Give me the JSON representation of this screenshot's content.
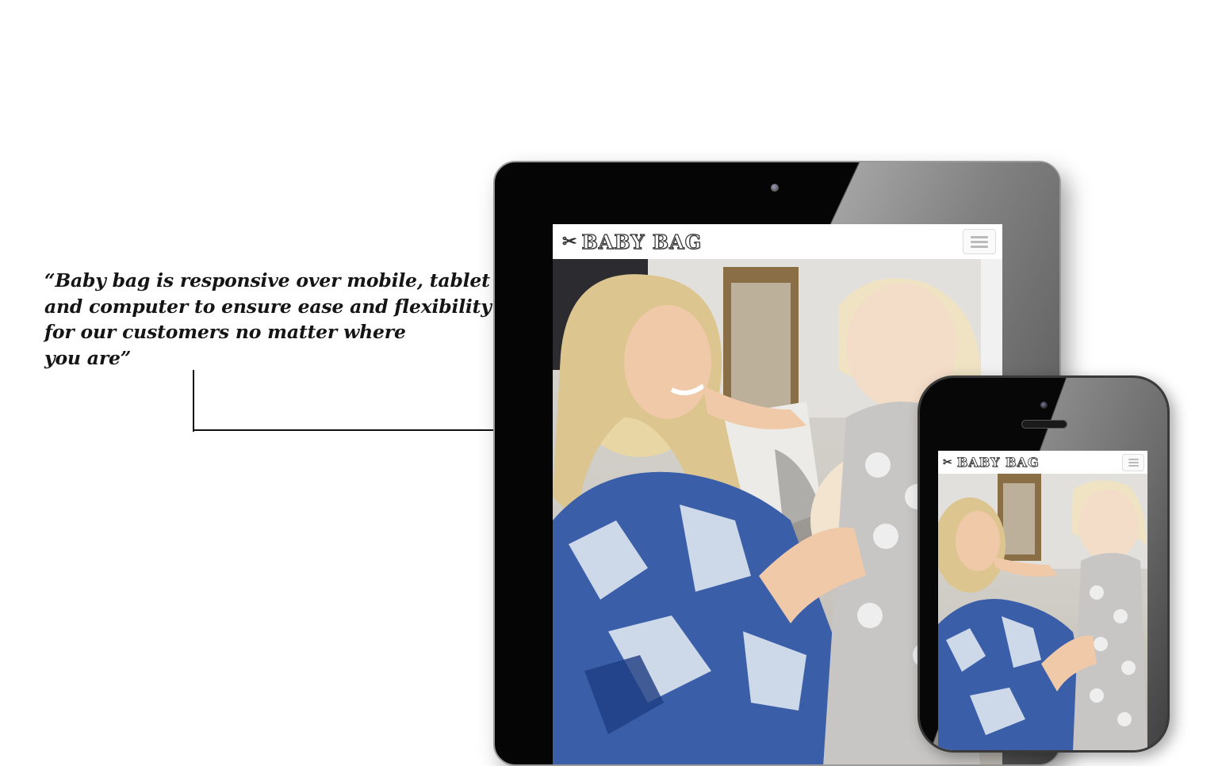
{
  "quote": {
    "lines": [
      "“Baby bag is responsive over mobile, tablet",
      "and computer to ensure ease and flexibility",
      "for our customers  no matter where",
      "you are”"
    ]
  },
  "site": {
    "brand": "BABY BAG",
    "logo_icon": "pacifier-icon",
    "menu_icon": "hamburger-menu-icon",
    "hero_image": "mother-and-toddler-photo"
  },
  "colors": {
    "device_body": "#050505",
    "text": "#151515",
    "shirt_blue": "#3a5fa8",
    "background": "#ffffff"
  }
}
